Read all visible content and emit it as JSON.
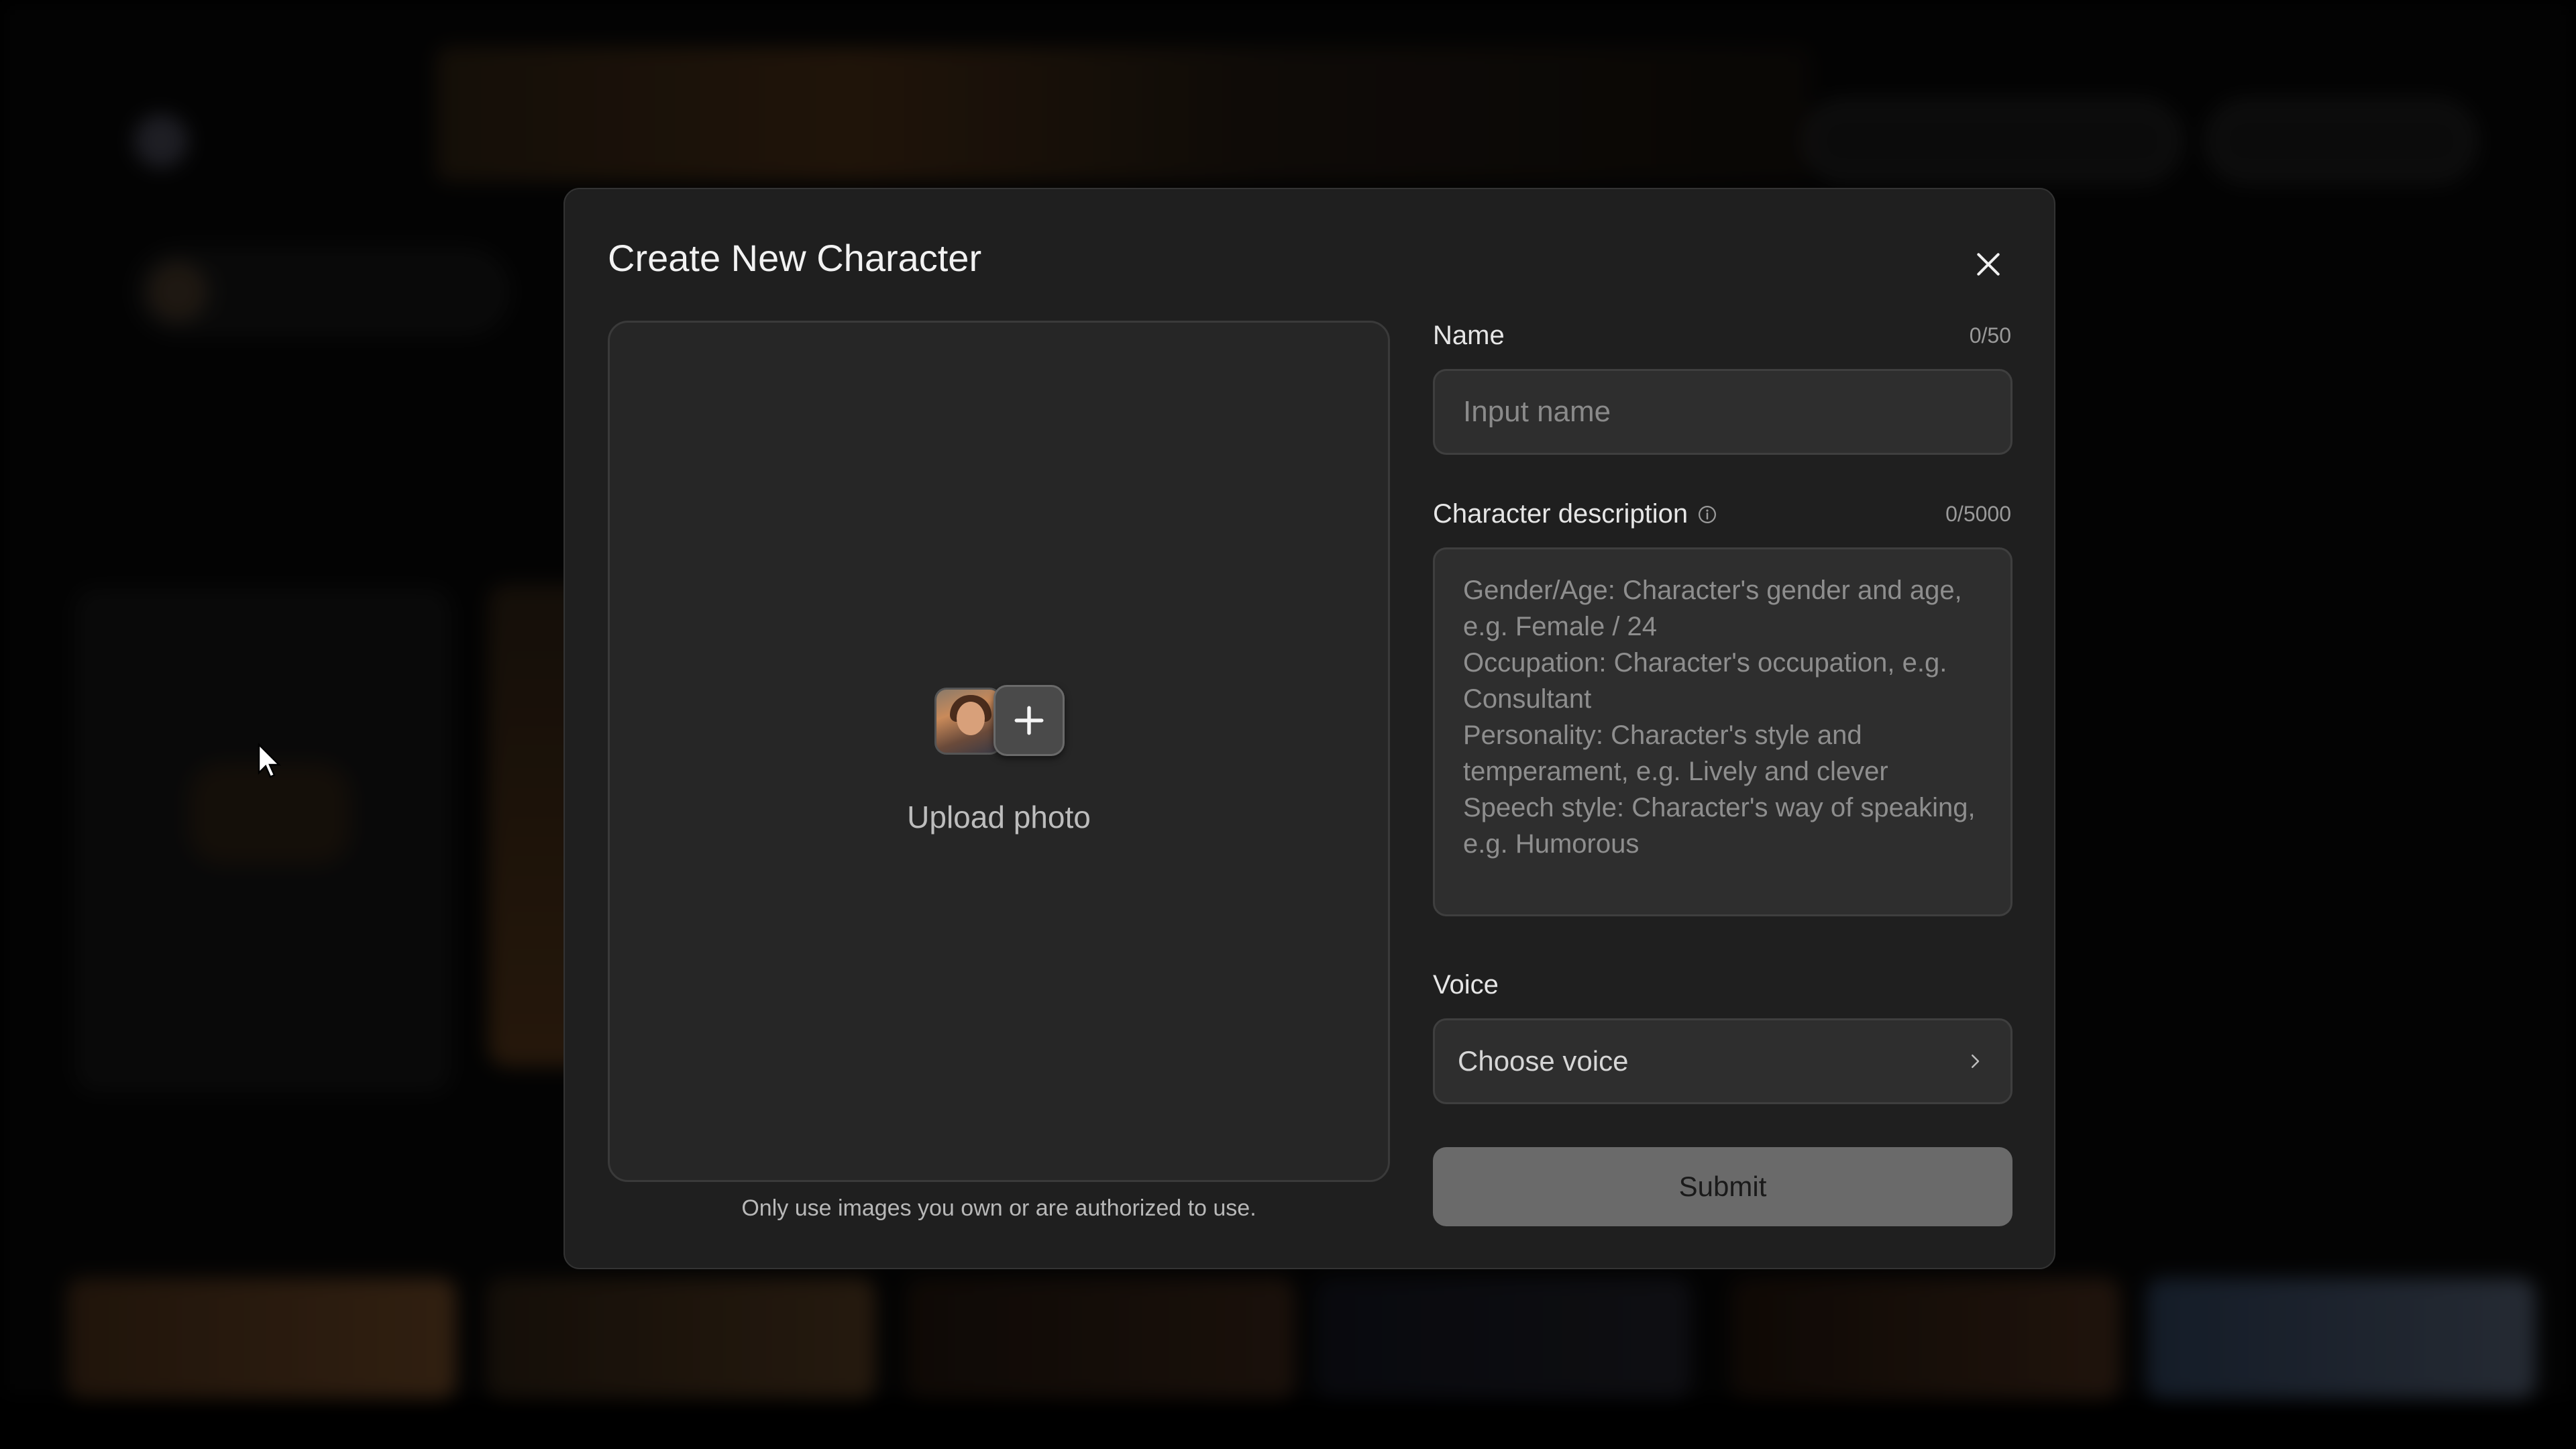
{
  "modal": {
    "title": "Create New Character",
    "upload": {
      "label": "Upload photo",
      "note": "Only use images you own or are authorized to use."
    },
    "name": {
      "label": "Name",
      "counter": "0/50",
      "value": "",
      "placeholder": "Input name"
    },
    "description": {
      "label": "Character description",
      "counter": "0/5000",
      "value": "",
      "placeholder": "Gender/Age: Character's gender and age, e.g. Female / 24\nOccupation: Character's occupation, e.g. Consultant\nPersonality: Character's style and temperament, e.g. Lively and clever\nSpeech style: Character's way of speaking, e.g. Humorous"
    },
    "voice": {
      "label": "Voice",
      "selected": "Choose voice"
    },
    "submit_label": "Submit"
  },
  "icons": {
    "close": "close-icon",
    "info": "info-icon",
    "chevron": "chevron-right-icon",
    "plus": "plus-icon",
    "photo": "photo-thumbnail-icon"
  },
  "colors": {
    "modal_bg": "#1f1f1f",
    "input_bg": "#2e2e2e",
    "submit_bg": "#6a6a6a"
  }
}
